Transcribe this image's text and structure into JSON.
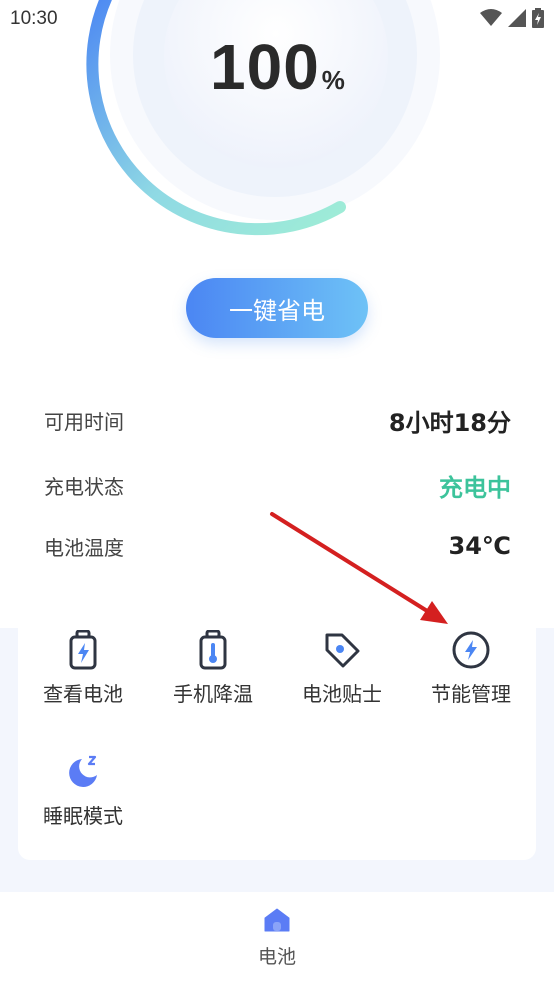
{
  "status_bar": {
    "time": "10:30"
  },
  "battery": {
    "level": 100,
    "number": "100",
    "unit": "%"
  },
  "save_button": {
    "label": "一键省电"
  },
  "info": [
    {
      "label": "可用时间",
      "value": "8小时18分"
    },
    {
      "label": "充电状态",
      "value": "充电中",
      "color": "#3cc39b"
    },
    {
      "label": "电池温度",
      "value": "34℃"
    }
  ],
  "features": [
    {
      "label": "查看电池",
      "icon": "battery-charge-icon"
    },
    {
      "label": "手机降温",
      "icon": "battery-thermometer-icon"
    },
    {
      "label": "电池贴士",
      "icon": "tag-icon"
    },
    {
      "label": "节能管理",
      "icon": "lightning-circle-icon"
    },
    {
      "label": "睡眠模式",
      "icon": "moon-sleep-icon"
    }
  ],
  "bottom_nav": {
    "items": [
      {
        "label": "电池",
        "icon": "home-icon"
      }
    ]
  },
  "colors": {
    "accent": "#4b86f3",
    "green": "#3cc39b",
    "arrow": "#d42020",
    "icon": "#2f3542",
    "moon": "#5b7cf5"
  }
}
